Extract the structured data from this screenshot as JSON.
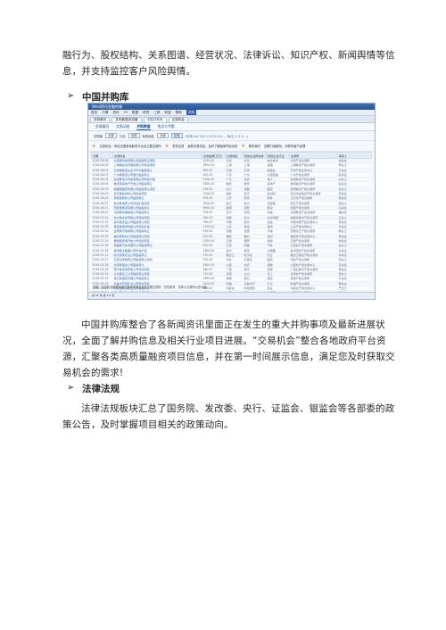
{
  "doc": {
    "intro_lines": [
      "融行为、股权结构、关系图谱、经营状况、法律诉讼、知识产权、新闻舆情等信",
      "息，并支持监控客户风险舆情。"
    ],
    "section1_title": "中国并购库",
    "section1_lines": [
      "中国并购库整合了各新闻资讯里面正在发生的重大并购事项及最新进展状",
      "况，全面了解并购信息及相关行业项目进展。“交易机会”整合各地政府平台资",
      "源，汇聚各类高质量融资项目信息，并在第一时间展示信息，满足您及时获取交",
      "易机会的需求!"
    ],
    "section2_title": "法律法规",
    "section2_lines": [
      "法律法规板块汇总了国务院、发改委、央行、证监会、银监会等各部委的政",
      "策公告，及时掌握项目相关的政策动向。"
    ],
    "bullet_glyph": "➢"
  },
  "screenshot": {
    "window_title": "Wind资讯金融终端",
    "menu": [
      "首页",
      "行情",
      "资讯",
      "F9",
      "数据",
      "研究",
      "工具",
      "财富",
      "帮助"
    ],
    "menu_highlight": "并购",
    "tabs": [
      "并购事件",
      "并购数据浏览器",
      "中国并购库",
      "交易机会"
    ],
    "active_tab": 2,
    "subtabs": [
      "交易概况",
      "交易动态",
      "并购数据",
      "热点与专题"
    ],
    "filters": {
      "label1": "并购库",
      "value1": "全部",
      "label2": "行业",
      "value2": "全国",
      "label3": "标的地区",
      "value3": "全部",
      "search_button": "检索",
      "hint": "(字母: A-F B-G C-H D-I E-J ... 标注: 1 2 3 ...)"
    },
    "notice": {
      "left": "交易机会 - 来自全国各地政府平台及主要交易所",
      "mid": "发布交易",
      "mid_note": "最新交易机会，及时了解最新项目动态",
      "right": "联系我们",
      "right_note": "如需订阅服务，请联系客户经理"
    },
    "columns": [
      "日期",
      "交易机会",
      "交易金额(万元)",
      "交易地区",
      "标的企业所在地",
      "标的企业行业",
      "交易所",
      "联系人"
    ],
    "rows": [
      [
        "2016-06-06",
        "北京某科技有限公司股权转让项目",
        "1234.00",
        "北京",
        "北京",
        "信息技术",
        "北京产权交易所",
        "张先生"
      ],
      [
        "2016-06-06",
        "上海某投资管理有限公司增资项目",
        "5600.00",
        "上海",
        "上海",
        "金融",
        "上海联合产权交易所",
        "李女士"
      ],
      [
        "2016-06-05",
        "天津某制造企业100%股权转让",
        "890.00",
        "天津",
        "天津",
        "制造业",
        "天津产权交易中心",
        "王先生"
      ],
      [
        "2016-06-05",
        "广州某物流公司部分股权转让",
        "345.00",
        "广东",
        "广州",
        "交通运输",
        "广州产权交易所",
        "陈先生"
      ],
      [
        "2016-06-04",
        "深圳某电子科技有限公司增资扩股",
        "2100.00",
        "广东",
        "深圳",
        "电子",
        "深圳联合产权交易所",
        "刘女士"
      ],
      [
        "2016-06-04",
        "重庆某房地产开发公司股权转让",
        "7800.00",
        "重庆",
        "重庆",
        "房地产",
        "重庆联合产权交易所",
        "赵先生"
      ],
      [
        "2016-06-03",
        "成都某医药有限公司股权转让项目",
        "456.00",
        "四川",
        "成都",
        "医药",
        "西南联合产权交易所",
        "孙女士"
      ],
      [
        "2016-06-03",
        "武汉某新材料公司增资项目",
        "1500.00",
        "湖北",
        "武汉",
        "新材料",
        "武汉光谷联合产权交易所",
        "周先生"
      ],
      [
        "2016-06-02",
        "南京某软件公司股权转让",
        "678.00",
        "江苏",
        "南京",
        "软件",
        "江苏省产权交易所",
        "吴先生"
      ],
      [
        "2016-06-02",
        "杭州某电商公司增资扩股项目",
        "3200.00",
        "浙江",
        "杭州",
        "互联网",
        "浙江产权交易所",
        "郑女士"
      ],
      [
        "2016-06-01",
        "西安某能源有限公司股权转让",
        "9900.00",
        "陕西",
        "西安",
        "能源",
        "西部产权交易所",
        "冯先生"
      ],
      [
        "2016-06-01",
        "沈阳某机械制造公司股权转让",
        "234.00",
        "辽宁",
        "沈阳",
        "机械",
        "沈阳联合产权交易所",
        "褚先生"
      ],
      [
        "2016-05-31",
        "长沙某文化传媒公司增资项目",
        "560.00",
        "湖南",
        "长沙",
        "文化传媒",
        "湖南省联合产权交易所",
        "卫女士"
      ],
      [
        "2016-05-31",
        "郑州某食品公司股权转让项目",
        "780.00",
        "河南",
        "郑州",
        "食品",
        "河南中原产权交易中心",
        "蒋先生"
      ],
      [
        "2016-05-30",
        "青岛某海洋科技公司增资扩股",
        "1100.00",
        "山东",
        "青岛",
        "海洋",
        "山东产权交易中心",
        "沈先生"
      ],
      [
        "2016-05-30",
        "合肥某环保有限公司股权转让",
        "430.00",
        "安徽",
        "合肥",
        "环保",
        "安徽长江产权交易所",
        "韩女士"
      ],
      [
        "2016-05-29",
        "福州某建材公司股权转让项目",
        "320.00",
        "福建",
        "福州",
        "建材",
        "福建省产权交易中心",
        "杨先生"
      ],
      [
        "2016-05-29",
        "昆明某旅游开发公司增资项目",
        "2500.00",
        "云南",
        "昆明",
        "旅游",
        "云南产权交易所",
        "朱先生"
      ],
      [
        "2016-05-28",
        "南昌某汽车零部件公司股权转让",
        "610.00",
        "江西",
        "南昌",
        "汽车",
        "江西省产权交易所",
        "秦女士"
      ],
      [
        "2016-05-28",
        "贵阳某大数据公司增资扩股",
        "1800.00",
        "贵州",
        "贵阳",
        "大数据",
        "贵州阳光产权交易所",
        "尤先生"
      ],
      [
        "2016-05-27",
        "哈尔滨某农业公司股权转让",
        "270.00",
        "黑龙江",
        "哈尔滨",
        "农业",
        "黑龙江联合产权交易所",
        "许先生"
      ],
      [
        "2016-05-27",
        "石家庄某制药公司股权转让项目",
        "950.00",
        "河北",
        "石家庄",
        "医药",
        "河北产权交易所",
        "何女士"
      ],
      [
        "2016-05-26",
        "太原某煤业公司股权转让",
        "4300.00",
        "山西",
        "太原",
        "煤炭",
        "山西省产权交易中心",
        "吕先生"
      ],
      [
        "2016-05-26",
        "南宁某贸易有限公司增资项目",
        "380.00",
        "广西",
        "南宁",
        "贸易",
        "广西北部湾产权交易所",
        "施先生"
      ],
      [
        "2016-05-25",
        "兰州某化工公司股权转让项目",
        "720.00",
        "甘肃",
        "兰州",
        "化工",
        "甘肃省产权交易所",
        "张女士"
      ],
      [
        "2016-05-25",
        "海口某酒店管理公司股权转让",
        "1650.00",
        "海南",
        "海口",
        "酒店",
        "海南产权交易所",
        "孔先生"
      ],
      [
        "2016-05-24",
        "乌鲁木齐某矿业公司增资项目",
        "5200.00",
        "新疆",
        "乌鲁木齐",
        "矿业",
        "新疆产权交易所",
        "曹先生"
      ],
      [
        "2016-05-24",
        "呼和浩特某乳业公司股权转让",
        "890.00",
        "内蒙古",
        "呼和浩特",
        "乳业",
        "内蒙古产权交易中心",
        "严女士"
      ],
      [
        "2016-05-23",
        "银川某光伏公司增资扩股项目",
        "2300.00",
        "宁夏",
        "银川",
        "新能源",
        "宁夏产权交易所",
        "华先生"
      ],
      [
        "2016-05-23",
        "西宁某资源开发公司股权转让",
        "1400.00",
        "青海",
        "西宁",
        "资源",
        "青海省产权交易市场",
        "金先生"
      ],
      [
        "2016-05-22",
        "拉萨某商贸公司股权转让项目",
        "260.00",
        "西藏",
        "拉萨",
        "商贸",
        "西藏产权交易中心",
        "魏女士"
      ]
    ],
    "footnote": "说明：交易机会数据来源于各地政府平台及主要交易所，仅供参考，具体以交易所公告为准。",
    "pager": "共 31 条  第 1/1 页"
  }
}
